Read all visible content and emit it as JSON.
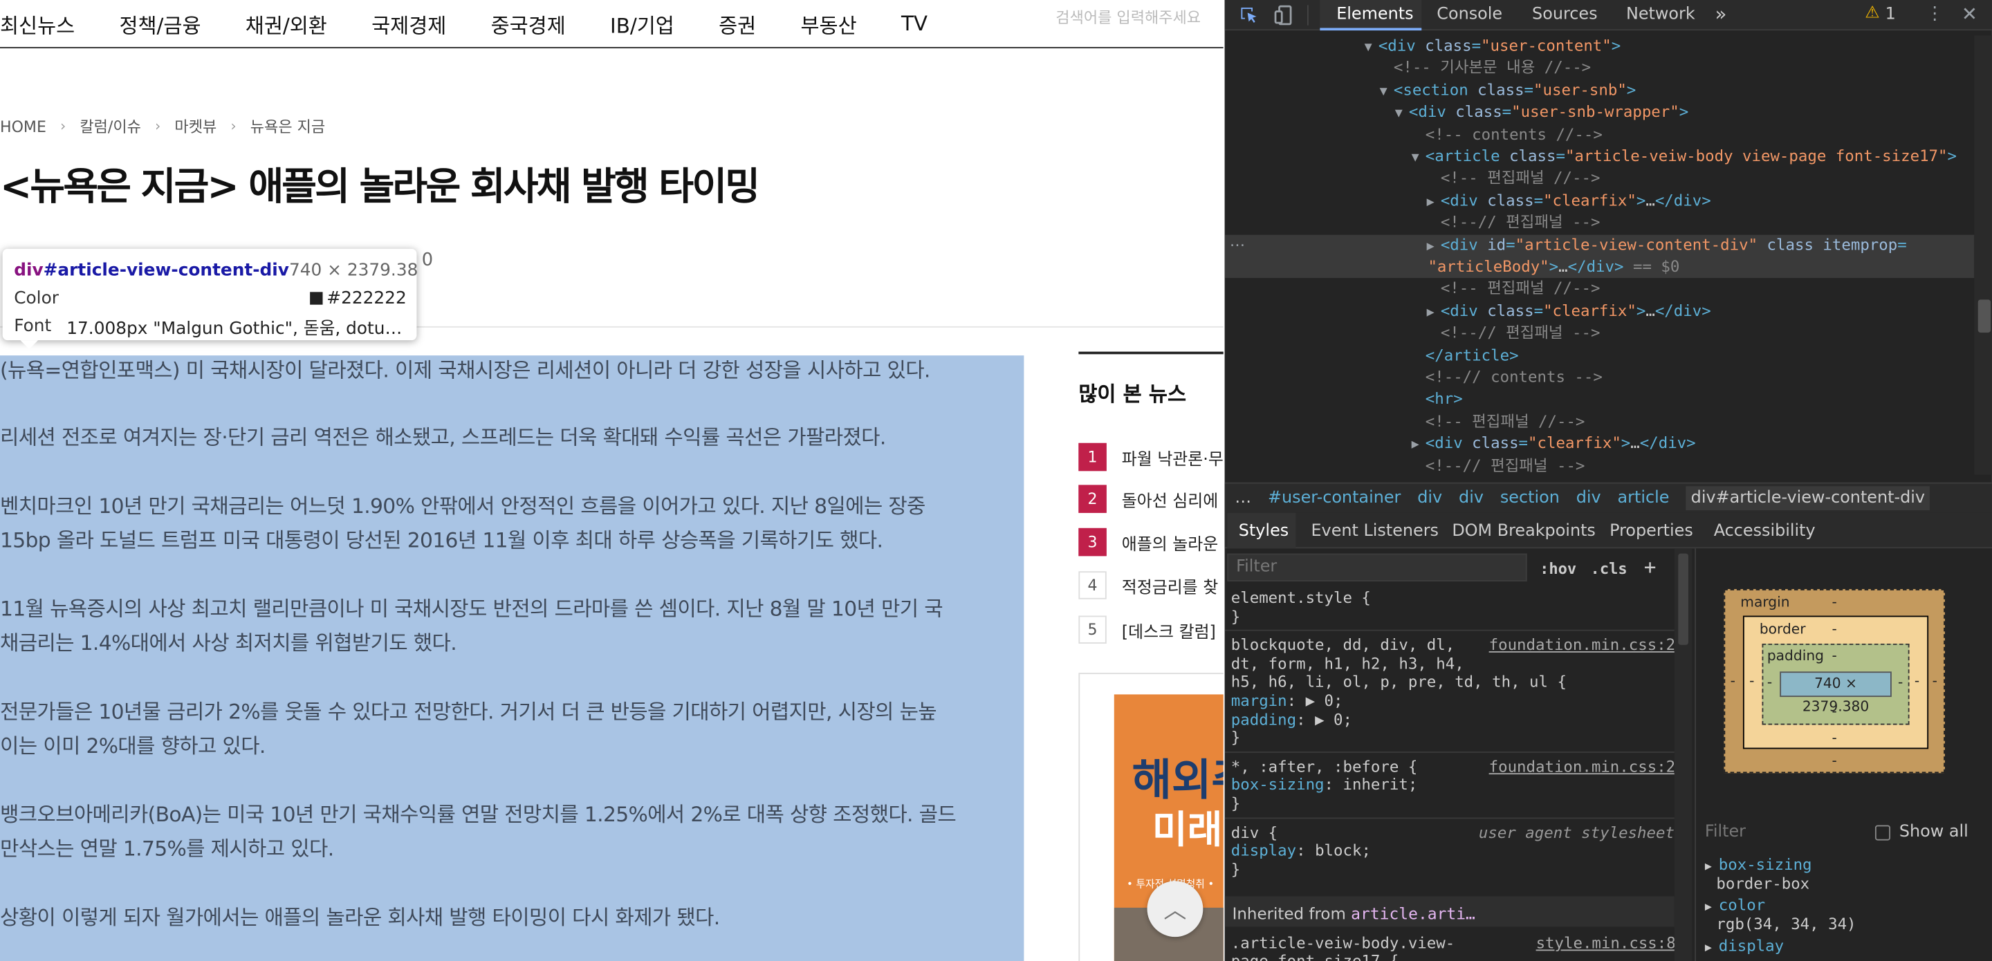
{
  "nav": {
    "items": [
      "최신뉴스",
      "정책/금융",
      "채권/외환",
      "국제경제",
      "중국경제",
      "IB/기업",
      "증권",
      "부동산",
      "TV"
    ],
    "search_placeholder": "검색어를 입력해주세요"
  },
  "breadcrumb": [
    "HOME",
    "칼럼/이슈",
    "마켓뷰",
    "뉴욕은 지금"
  ],
  "article": {
    "headline": "<뉴욕은 지금> 애플의 놀라운 회사채 발행 타이밍",
    "byline_fragment": "0",
    "paragraphs": [
      [
        "(뉴욕=연합인포맥스) 미 국채시장이 달라졌다. 이제 국채시장은 리세션이 아니라 더 강한 성장을 시사하고 있다."
      ],
      [
        "리세션 전조로 여겨지는 장·단기 금리 역전은 해소됐고, 스프레드는 더욱 확대돼 수익률 곡선은 가팔라졌다."
      ],
      [
        "벤치마크인 10년 만기 국채금리는 어느덧 1.90% 안팎에서 안정적인 흐름을 이어가고 있다. 지난 8일에는 장중",
        "15bp 올라 도널드 트럼프 미국 대통령이 당선된 2016년 11월 이후 최대 하루 상승폭을 기록하기도 했다."
      ],
      [
        "11월 뉴욕증시의 사상 최고치 랠리만큼이나 미 국채시장도 반전의 드라마를 쓴 셈이다. 지난 8월 말 10년 만기 국",
        "채금리는 1.4%대에서 사상 최저치를 위협받기도 했다."
      ],
      [
        "전문가들은 10년물 금리가 2%를 웃돌 수 있다고 전망한다. 거기서 더 큰 반등을 기대하기 어렵지만, 시장의 눈높",
        "이는 이미 2%대를 향하고 있다."
      ],
      [
        "뱅크오브아메리카(BoA)는 미국 10년 만기 국채수익률 연말 전망치를 1.25%에서 2%로 대폭 상향 조정했다. 골드",
        "만삭스는 연말 1.75%를 제시하고 있다."
      ],
      [
        "상황이 이렇게 되자 월가에서는 애플의 놀라운 회사채 발행 타이밍이 다시 화제가 됐다."
      ]
    ]
  },
  "inspect_tooltip": {
    "tag": "div",
    "id": "#article-view-content-div",
    "size": "740 × 2379.38",
    "color_label": "Color",
    "color_value": "#222222",
    "font_label": "Font",
    "font_value": "17.008px \"Malgun Gothic\", 돋움, dotum,..."
  },
  "sidebar": {
    "title": "많이 본 뉴스",
    "items": [
      {
        "rank": "1",
        "title": "파월 낙관론·무"
      },
      {
        "rank": "2",
        "title": "돌아선 심리에"
      },
      {
        "rank": "3",
        "title": "애플의 놀라운"
      },
      {
        "rank": "4",
        "title": "적정금리를 찾"
      },
      {
        "rank": "5",
        "title": "[데스크 칼럼]"
      }
    ],
    "ad_text": [
      "해외주",
      "미래",
      "• 투자전 설명청취 •"
    ]
  },
  "devtools": {
    "tabs": [
      "Elements",
      "Console",
      "Sources",
      "Network"
    ],
    "more": "»",
    "warnings": "1",
    "dom_lines": [
      {
        "indent": 0,
        "toggle": "▼",
        "parts": [
          [
            "tg",
            "<div "
          ],
          [
            "at",
            "class"
          ],
          [
            "tg",
            "="
          ],
          [
            "av",
            "\"user-content\""
          ],
          [
            "tg",
            ">"
          ]
        ]
      },
      {
        "indent": 1,
        "toggle": "",
        "parts": [
          [
            "cm",
            "<!-- 기사본문 내용 //-->"
          ]
        ]
      },
      {
        "indent": 1,
        "toggle": "▼",
        "parts": [
          [
            "tg",
            "<section "
          ],
          [
            "at",
            "class"
          ],
          [
            "tg",
            "="
          ],
          [
            "av",
            "\"user-snb\""
          ],
          [
            "tg",
            ">"
          ]
        ]
      },
      {
        "indent": 2,
        "toggle": "▼",
        "parts": [
          [
            "tg",
            "<div "
          ],
          [
            "at",
            "class"
          ],
          [
            "tg",
            "="
          ],
          [
            "av",
            "\"user-snb-wrapper\""
          ],
          [
            "tg",
            ">"
          ]
        ]
      },
      {
        "indent": 3,
        "toggle": "",
        "parts": [
          [
            "cm",
            "<!-- contents //-->"
          ]
        ]
      },
      {
        "indent": 3,
        "toggle": "▼",
        "parts": [
          [
            "tg",
            "<article "
          ],
          [
            "at",
            "class"
          ],
          [
            "tg",
            "="
          ],
          [
            "av",
            "\"article-veiw-body view-page font-size17\""
          ],
          [
            "tg",
            ">"
          ]
        ]
      },
      {
        "indent": 4,
        "toggle": "",
        "parts": [
          [
            "cm",
            "<!-- 편집패널 //-->"
          ]
        ]
      },
      {
        "indent": 4,
        "toggle": "▶",
        "parts": [
          [
            "tg",
            "<div "
          ],
          [
            "at",
            "class"
          ],
          [
            "tg",
            "="
          ],
          [
            "av",
            "\"clearfix\""
          ],
          [
            "tg",
            ">"
          ],
          [
            "tx",
            "…"
          ],
          [
            "tg",
            "</div>"
          ]
        ]
      },
      {
        "indent": 4,
        "toggle": "",
        "parts": [
          [
            "cm",
            "<!--// 편집패널 -->"
          ]
        ]
      },
      {
        "indent": 4,
        "toggle": "▶",
        "parts": [
          [
            "tg",
            "<div "
          ],
          [
            "at",
            "id"
          ],
          [
            "tg",
            "="
          ],
          [
            "av",
            "\"article-view-content-div\""
          ],
          [
            "at",
            " class itemprop"
          ],
          [
            "tg",
            "="
          ]
        ]
      },
      {
        "indent": -1,
        "toggle": "",
        "parts": [
          [
            "av",
            "\"articleBody\""
          ],
          [
            "tg",
            ">"
          ],
          [
            "tx",
            "…"
          ],
          [
            "tg",
            "</div>"
          ],
          [
            "cm",
            " == $0"
          ]
        ]
      },
      {
        "indent": 4,
        "toggle": "",
        "parts": [
          [
            "cm",
            "<!-- 편집패널 //-->"
          ]
        ]
      },
      {
        "indent": 4,
        "toggle": "▶",
        "parts": [
          [
            "tg",
            "<div "
          ],
          [
            "at",
            "class"
          ],
          [
            "tg",
            "="
          ],
          [
            "av",
            "\"clearfix\""
          ],
          [
            "tg",
            ">"
          ],
          [
            "tx",
            "…"
          ],
          [
            "tg",
            "</div>"
          ]
        ]
      },
      {
        "indent": 4,
        "toggle": "",
        "parts": [
          [
            "cm",
            "<!--// 편집패널 -->"
          ]
        ]
      },
      {
        "indent": 3,
        "toggle": "",
        "parts": [
          [
            "tg",
            "</article>"
          ]
        ]
      },
      {
        "indent": 3,
        "toggle": "",
        "parts": [
          [
            "cm",
            "<!--// contents -->"
          ]
        ]
      },
      {
        "indent": 3,
        "toggle": "",
        "parts": [
          [
            "tg",
            "<hr>"
          ]
        ]
      },
      {
        "indent": 3,
        "toggle": "",
        "parts": [
          [
            "cm",
            "<!-- 편집패널 //-->"
          ]
        ]
      },
      {
        "indent": 3,
        "toggle": "▶",
        "parts": [
          [
            "tg",
            "<div "
          ],
          [
            "at",
            "class"
          ],
          [
            "tg",
            "="
          ],
          [
            "av",
            "\"clearfix\""
          ],
          [
            "tg",
            ">"
          ],
          [
            "tx",
            "…"
          ],
          [
            "tg",
            "</div>"
          ]
        ]
      },
      {
        "indent": 3,
        "toggle": "",
        "parts": [
          [
            "cm",
            "<!--// 편집패널 -->"
          ]
        ]
      }
    ],
    "crumbs": [
      "…",
      "#user-container",
      "div",
      "div",
      "section",
      "div",
      "article",
      "div#article-view-content-div"
    ],
    "subtabs": [
      "Styles",
      "Event Listeners",
      "DOM Breakpoints",
      "Properties",
      "Accessibility"
    ],
    "filter_placeholder": "Filter",
    "hov": ":hov",
    "cls": ".cls",
    "plus": "+",
    "styles_lines": [
      {
        "parts": [
          [
            "sel",
            "element.style {"
          ]
        ]
      },
      {
        "parts": [
          [
            "sel",
            "}"
          ]
        ]
      },
      {
        "sep": true
      },
      {
        "parts": [
          [
            "sel",
            "blockquote, dd, div, dl,"
          ]
        ],
        "src": "foundation.min.css:2"
      },
      {
        "parts": [
          [
            "sel",
            "dt, form, h1, h2, h3, h4,"
          ]
        ]
      },
      {
        "parts": [
          [
            "sel",
            "h5, h6, li, ol, p, pre, td, th, ul {"
          ]
        ]
      },
      {
        "parts": [
          [
            "pn",
            "  margin"
          ],
          [
            "pv",
            ": ▶ 0;"
          ]
        ]
      },
      {
        "parts": [
          [
            "pn",
            "  padding"
          ],
          [
            "pv",
            ": ▶ 0;"
          ]
        ]
      },
      {
        "parts": [
          [
            "sel",
            "}"
          ]
        ]
      },
      {
        "sep": true
      },
      {
        "parts": [
          [
            "sel",
            "*, :after, :before {"
          ]
        ],
        "src": "foundation.min.css:2"
      },
      {
        "parts": [
          [
            "pn",
            "  box-sizing"
          ],
          [
            "pv",
            ": inherit;"
          ]
        ]
      },
      {
        "parts": [
          [
            "sel",
            "}"
          ]
        ]
      },
      {
        "sep": true
      },
      {
        "parts": [
          [
            "sel",
            "div {"
          ]
        ],
        "ua": "user agent stylesheet"
      },
      {
        "parts": [
          [
            "pn",
            "  display"
          ],
          [
            "pv",
            ": block;"
          ]
        ]
      },
      {
        "parts": [
          [
            "sel",
            "}"
          ]
        ]
      }
    ],
    "inherited_label": "Inherited from",
    "inherited_el": "article.arti…",
    "last_rule": ".article-veiw-body.view-",
    "last_rule2": "page font-size17 {",
    "last_rule_src": "style.min.css:8",
    "box_model": {
      "margin": "margin",
      "border": "border",
      "padding": "padding",
      "content": "740 × 2379.380",
      "dash": "-"
    },
    "computed_filter": "Filter",
    "show_all": "Show all",
    "computed": [
      {
        "name": "box-sizing",
        "value": "border-box"
      },
      {
        "name": "color",
        "value": "rgb(34, 34, 34)"
      },
      {
        "name": "display",
        "value": ""
      }
    ]
  }
}
